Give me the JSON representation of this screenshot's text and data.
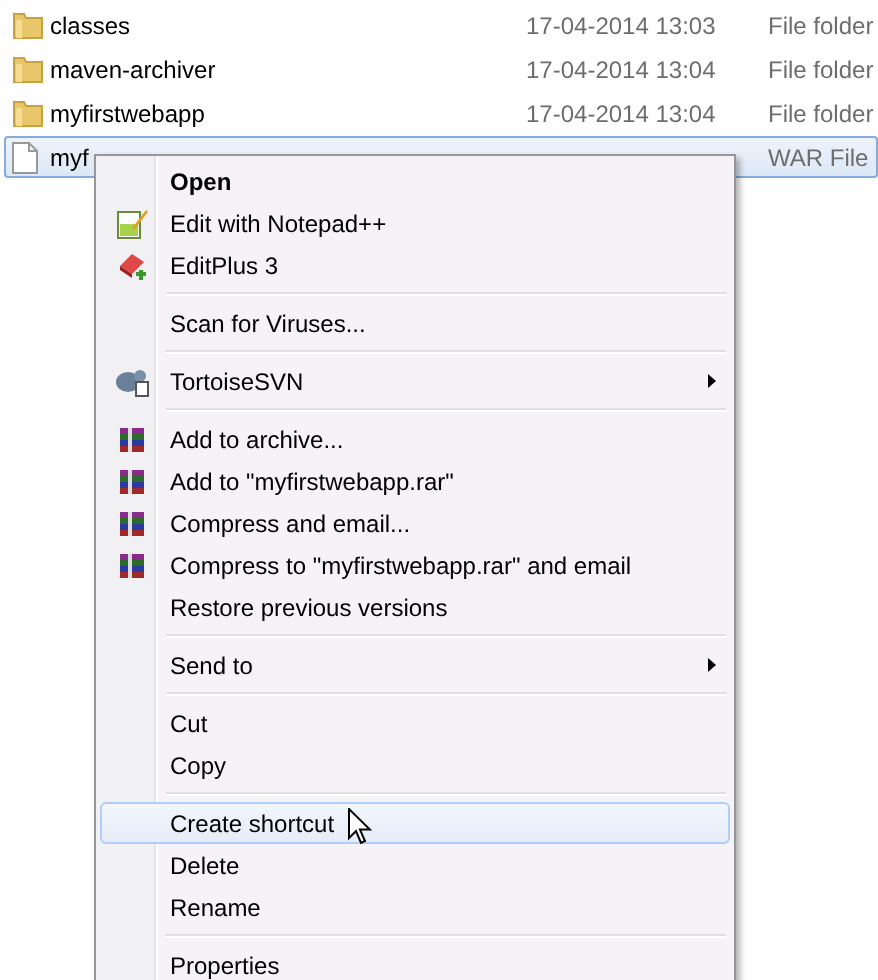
{
  "files": [
    {
      "name": "classes",
      "modified": "17-04-2014 13:03",
      "type": "File folder",
      "kind": "folder",
      "selected": false
    },
    {
      "name": "maven-archiver",
      "modified": "17-04-2014 13:04",
      "type": "File folder",
      "kind": "folder",
      "selected": false
    },
    {
      "name": "myfirstwebapp",
      "modified": "17-04-2014 13:04",
      "type": "File folder",
      "kind": "folder",
      "selected": false
    },
    {
      "name": "myf",
      "type": "WAR File",
      "kind": "file",
      "selected": true
    }
  ],
  "context_menu": [
    {
      "kind": "plain",
      "label": "Open",
      "bold": true,
      "submenu": false,
      "selected": false
    },
    {
      "kind": "notepad",
      "label": "Edit with Notepad++",
      "bold": false,
      "submenu": false,
      "selected": false
    },
    {
      "kind": "editplus",
      "label": "EditPlus 3",
      "bold": false,
      "submenu": false,
      "selected": false
    },
    {
      "kind": "separator"
    },
    {
      "kind": "plain",
      "label": "Scan for Viruses...",
      "bold": false,
      "submenu": false,
      "selected": false
    },
    {
      "kind": "separator"
    },
    {
      "kind": "svn",
      "label": "TortoiseSVN",
      "bold": false,
      "submenu": true,
      "selected": false
    },
    {
      "kind": "separator"
    },
    {
      "kind": "archive",
      "label": "Add to archive...",
      "bold": false,
      "submenu": false,
      "selected": false
    },
    {
      "kind": "archive",
      "label": "Add to \"myfirstwebapp.rar\"",
      "bold": false,
      "submenu": false,
      "selected": false
    },
    {
      "kind": "archive",
      "label": "Compress and email...",
      "bold": false,
      "submenu": false,
      "selected": false
    },
    {
      "kind": "archive",
      "label": "Compress to \"myfirstwebapp.rar\" and email",
      "bold": false,
      "submenu": false,
      "selected": false
    },
    {
      "kind": "plain",
      "label": "Restore previous versions",
      "bold": false,
      "submenu": false,
      "selected": false
    },
    {
      "kind": "separator"
    },
    {
      "kind": "plain",
      "label": "Send to",
      "bold": false,
      "submenu": true,
      "selected": false
    },
    {
      "kind": "separator"
    },
    {
      "kind": "plain",
      "label": "Cut",
      "bold": false,
      "submenu": false,
      "selected": false
    },
    {
      "kind": "plain",
      "label": "Copy",
      "bold": false,
      "submenu": false,
      "selected": false
    },
    {
      "kind": "separator"
    },
    {
      "kind": "plain",
      "label": "Create shortcut",
      "bold": false,
      "submenu": false,
      "selected": true
    },
    {
      "kind": "plain",
      "label": "Delete",
      "bold": false,
      "submenu": false,
      "selected": false
    },
    {
      "kind": "plain",
      "label": "Rename",
      "bold": false,
      "submenu": false,
      "selected": false
    },
    {
      "kind": "separator"
    },
    {
      "kind": "plain",
      "label": "Properties",
      "bold": false,
      "submenu": false,
      "selected": false
    }
  ]
}
